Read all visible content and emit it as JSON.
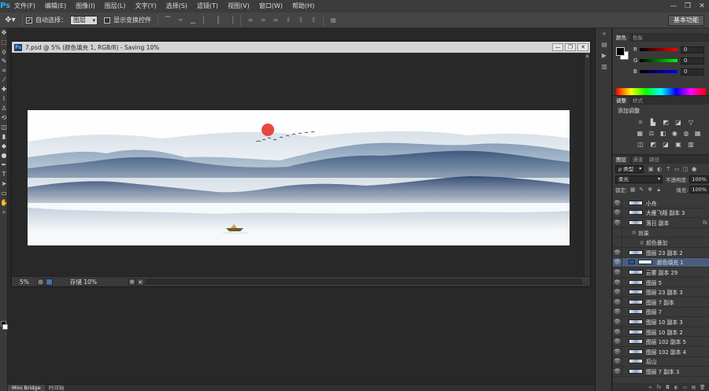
{
  "menubar": {
    "logo": "Ps",
    "items": [
      "文件(F)",
      "编辑(E)",
      "图像(I)",
      "图层(L)",
      "文字(Y)",
      "选择(S)",
      "滤镜(T)",
      "视图(V)",
      "窗口(W)",
      "帮助(H)"
    ],
    "window_controls": [
      "—",
      "❐",
      "✕"
    ]
  },
  "options": {
    "auto_select_label": "自动选择：",
    "auto_select_value": "图层",
    "show_transform_label": "显示变换控件",
    "workspace": "基本功能"
  },
  "document": {
    "title": "7.psd @ 5% (颜色填充 1, RGB/8) - Saving 10%",
    "zoom": "5%",
    "status": "存储 10%"
  },
  "bottom_tabs": [
    "Mini Bridge",
    "时间轴"
  ],
  "color_panel": {
    "tabs": [
      "颜色",
      "色板"
    ],
    "channels": [
      {
        "label": "R",
        "value": "0",
        "color": "#d81e1e"
      },
      {
        "label": "G",
        "value": "0",
        "color": "#1ea31e"
      },
      {
        "label": "B",
        "value": "0",
        "color": "#1e3fd8"
      }
    ]
  },
  "adjust_panel": {
    "tabs": [
      "调整",
      "样式"
    ],
    "title": "添加调整"
  },
  "layers_panel": {
    "tabs": [
      "图层",
      "通道",
      "路径"
    ],
    "filter": "ρ 类型",
    "blend_mode": "柔光",
    "opacity_label": "不透明度:",
    "opacity_value": "100%",
    "lock_label": "锁定:",
    "fill_label": "填充:",
    "fill_value": "100%",
    "layers": [
      {
        "name": "小舟",
        "fx": ""
      },
      {
        "name": "大雁飞翔 副本 3",
        "fx": ""
      },
      {
        "name": "落日 副本",
        "fx": "fx"
      },
      {
        "name": "效果",
        "fx": "",
        "effect": true
      },
      {
        "name": "颜色叠加",
        "fx": "",
        "effect": true
      },
      {
        "name": "图层 23 副本 2",
        "fx": ""
      },
      {
        "name": "颜色填充 1",
        "fx": "",
        "selected": true
      },
      {
        "name": "云雾 副本 29",
        "fx": ""
      },
      {
        "name": "图层 5",
        "fx": ""
      },
      {
        "name": "图层 23 副本 3",
        "fx": ""
      },
      {
        "name": "图层 7 副本",
        "fx": ""
      },
      {
        "name": "图层 7",
        "fx": ""
      },
      {
        "name": "图层 10 副本 3",
        "fx": ""
      },
      {
        "name": "图层 10 副本 2",
        "fx": ""
      },
      {
        "name": "图层 102 副本 5",
        "fx": ""
      },
      {
        "name": "图层 102 副本 4",
        "fx": ""
      },
      {
        "name": "后山",
        "fx": ""
      },
      {
        "name": "图层 7 副本 3",
        "fx": ""
      }
    ]
  }
}
